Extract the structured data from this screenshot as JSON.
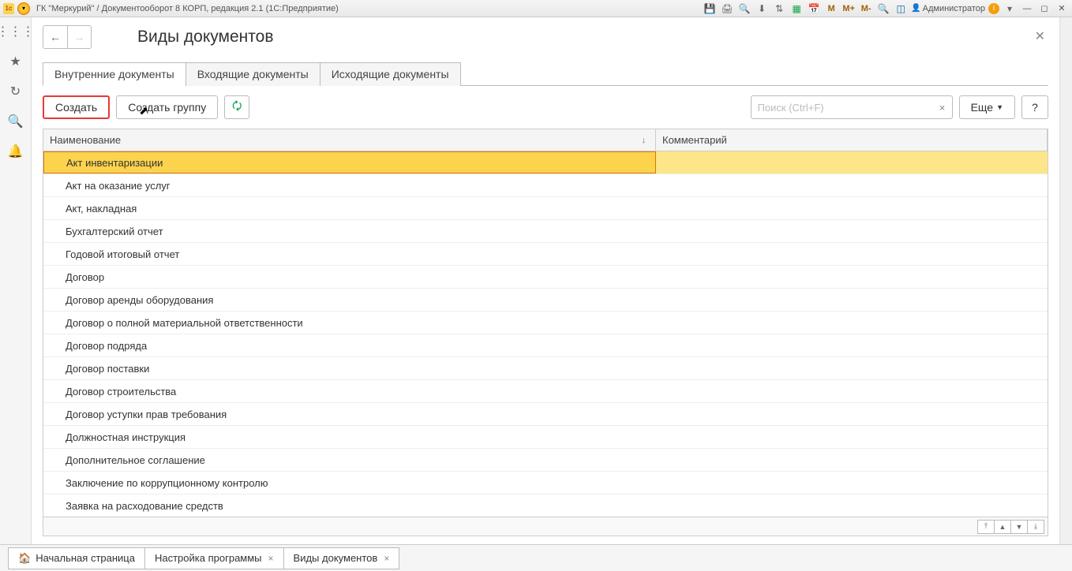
{
  "titlebar": {
    "text": "ГК \"Меркурий\" / Документооборот 8 КОРП, редакция 2.1  (1С:Предприятие)",
    "user": "Администратор",
    "m_icons": [
      "M",
      "M+",
      "M-"
    ]
  },
  "page": {
    "title": "Виды документов",
    "tabs": [
      {
        "label": "Внутренние документы",
        "active": true
      },
      {
        "label": "Входящие документы",
        "active": false
      },
      {
        "label": "Исходящие документы",
        "active": false
      }
    ],
    "toolbar": {
      "create": "Создать",
      "create_group": "Создать группу",
      "search_placeholder": "Поиск (Ctrl+F)",
      "more": "Еще",
      "help": "?"
    },
    "columns": {
      "name": "Наименование",
      "comment": "Комментарий"
    },
    "rows": [
      {
        "name": "Акт инвентаризации",
        "comment": "",
        "selected": true
      },
      {
        "name": "Акт на оказание услуг",
        "comment": ""
      },
      {
        "name": "Акт, накладная",
        "comment": ""
      },
      {
        "name": "Бухгалтерский отчет",
        "comment": ""
      },
      {
        "name": "Годовой итоговый отчет",
        "comment": ""
      },
      {
        "name": "Договор",
        "comment": ""
      },
      {
        "name": "Договор аренды оборудования",
        "comment": ""
      },
      {
        "name": "Договор о полной материальной ответственности",
        "comment": ""
      },
      {
        "name": "Договор подряда",
        "comment": ""
      },
      {
        "name": "Договор поставки",
        "comment": ""
      },
      {
        "name": "Договор строительства",
        "comment": ""
      },
      {
        "name": "Договор уступки прав требования",
        "comment": ""
      },
      {
        "name": "Должностная инструкция",
        "comment": ""
      },
      {
        "name": "Дополнительное соглашение",
        "comment": ""
      },
      {
        "name": "Заключение по коррупционному контролю",
        "comment": ""
      },
      {
        "name": "Заявка на расходование средств",
        "comment": ""
      }
    ]
  },
  "bottom_tabs": [
    {
      "label": "Начальная страница",
      "home": true,
      "closable": false
    },
    {
      "label": "Настройка программы",
      "home": false,
      "closable": true
    },
    {
      "label": "Виды документов",
      "home": false,
      "closable": true
    }
  ]
}
